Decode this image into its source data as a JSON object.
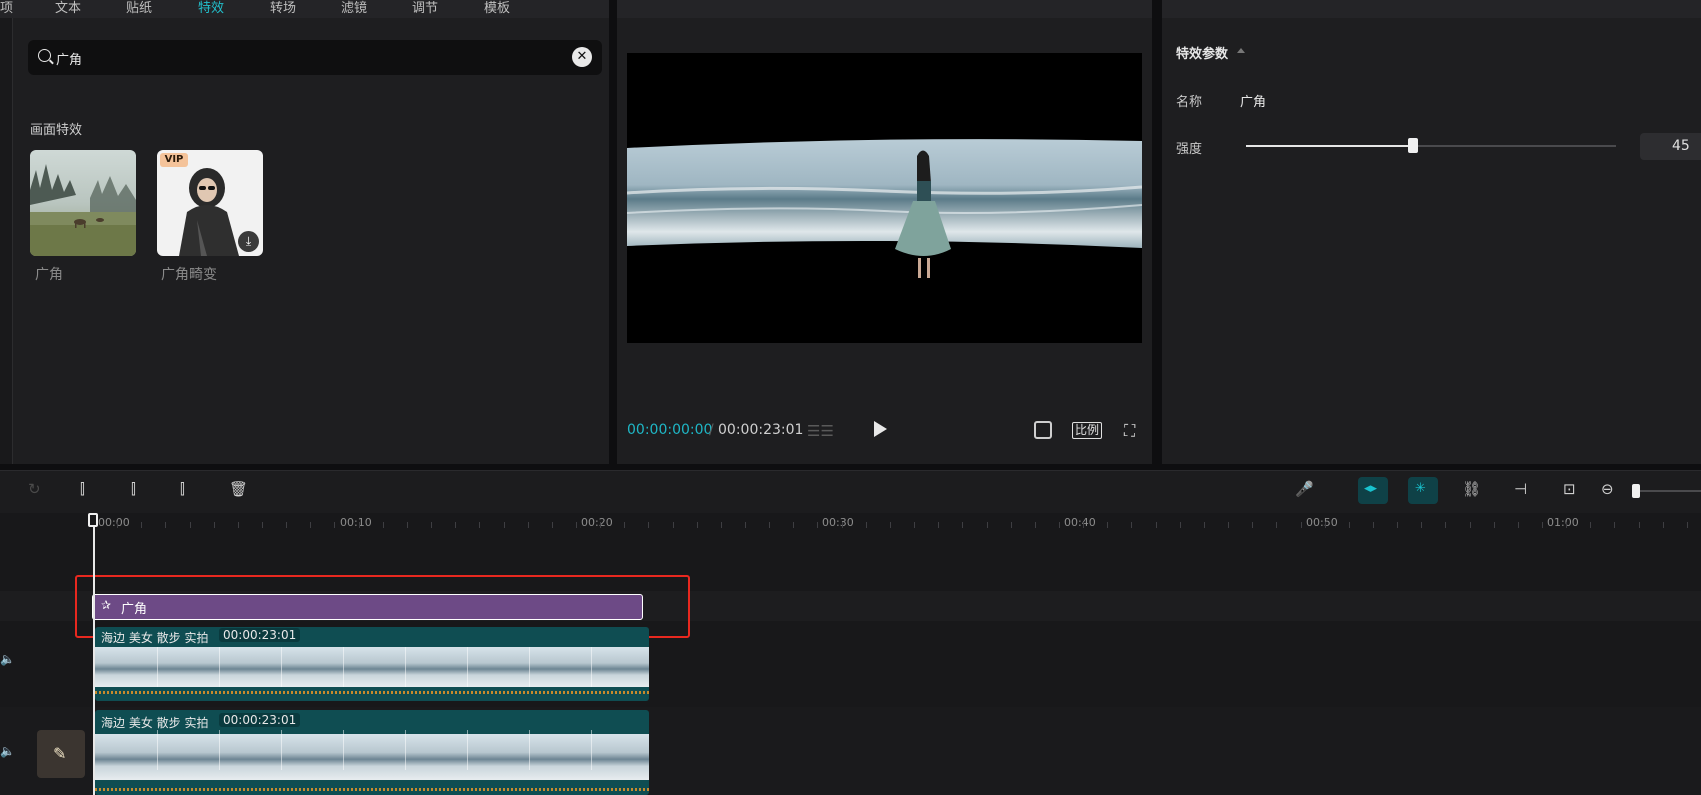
{
  "tabs": [
    "项",
    "文本",
    "贴纸",
    "特效",
    "转场",
    "滤镜",
    "调节",
    "模板"
  ],
  "active_tab_index": 3,
  "search": {
    "value": "广角",
    "clear_icon": "close-icon",
    "search_icon": "search-icon"
  },
  "effects": {
    "section_title": "画面特效",
    "items": [
      {
        "label": "广角",
        "vip": false
      },
      {
        "label": "广角畸变",
        "vip": true,
        "vip_badge": "VIP",
        "download_icon": "download-icon"
      }
    ]
  },
  "player": {
    "current_time": "00:00:00:00",
    "separator": "/",
    "total_time": "00:00:23:01",
    "ratio_label": "比例"
  },
  "params": {
    "title": "特效参数",
    "name_label": "名称",
    "name_value": "广角",
    "strength_label": "强度",
    "strength_value": "45",
    "strength_fraction": 0.45
  },
  "timeline": {
    "ticks": [
      "00:00",
      "00:10",
      "00:20",
      "00:30",
      "00:40",
      "00:50",
      "01:00"
    ],
    "effect_clip_label": "广角",
    "clips": [
      {
        "title": "海边 美女 散步 实拍",
        "duration": "00:00:23:01"
      },
      {
        "title": "海边 美女 散步 实拍",
        "duration": "00:00:23:01"
      }
    ]
  },
  "colors": {
    "accent": "#1fb7c6",
    "effect_clip": "#6d4a86",
    "video_clip": "#0f4d52",
    "highlight": "#e8281f"
  }
}
